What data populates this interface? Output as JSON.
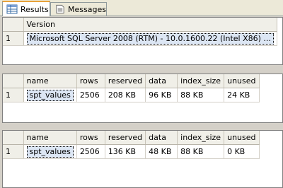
{
  "tabs": [
    {
      "label": "Results",
      "icon": "grid-icon",
      "active": true
    },
    {
      "label": "Messages",
      "icon": "messages-icon",
      "active": false
    }
  ],
  "grids": [
    {
      "columns": [
        "Version"
      ],
      "rows": [
        {
          "num": "1",
          "cells": [
            "Microsoft SQL Server 2008 (RTM) - 10.0.1600.22 (Intel X86) ..."
          ]
        }
      ]
    },
    {
      "columns": [
        "name",
        "rows",
        "reserved",
        "data",
        "index_size",
        "unused"
      ],
      "rows": [
        {
          "num": "1",
          "cells": [
            "spt_values",
            "2506",
            "208 KB",
            "96 KB",
            "88 KB",
            "24 KB"
          ]
        }
      ]
    },
    {
      "columns": [
        "name",
        "rows",
        "reserved",
        "data",
        "index_size",
        "unused"
      ],
      "rows": [
        {
          "num": "1",
          "cells": [
            "spt_values",
            "2506",
            "136 KB",
            "48 KB",
            "88 KB",
            "0 KB"
          ]
        }
      ]
    }
  ],
  "colors": {
    "background": "#d4d0c8",
    "header": "#f0efe8",
    "selected_cell": "#dce6f4",
    "active_tab_accent": "#e8a33c"
  }
}
